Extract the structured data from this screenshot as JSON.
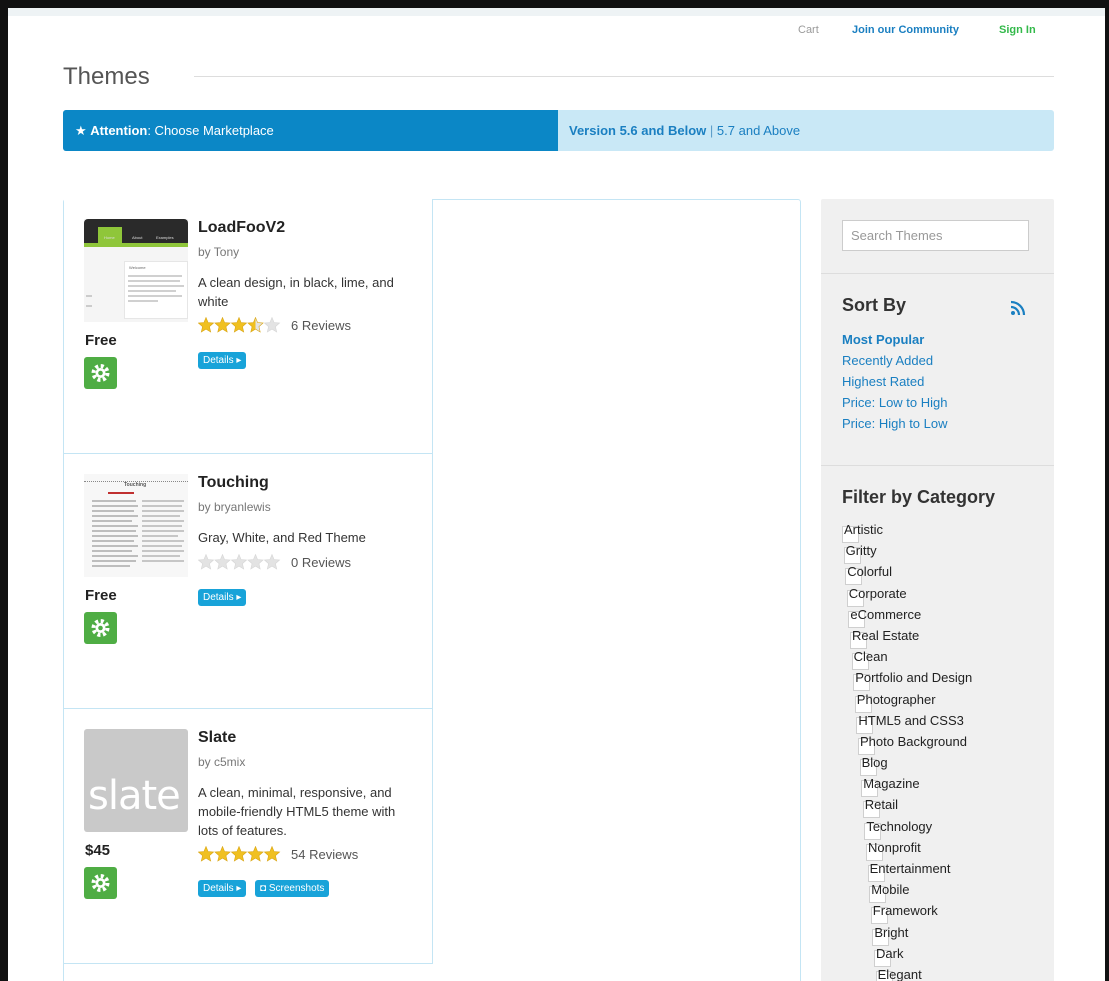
{
  "top_links": {
    "cart": "Cart",
    "join": "Join our Community",
    "sign_in": "Sign In"
  },
  "page_title": "Themes",
  "attention": {
    "label": "Attention",
    "text": ": Choose Marketplace",
    "version_old": "Version 5.6 and Below",
    "separator": "|",
    "version_new": "5.7 and Above"
  },
  "themes": [
    {
      "name": "LoadFooV2",
      "author": "by Tony",
      "description": "A clean design, in black, lime, and white",
      "rating": 3.5,
      "reviews": "6 Reviews",
      "price": "Free",
      "details_label": "Details",
      "thumb_caption": "Welcome"
    },
    {
      "name": "Touching",
      "author": "by bryanlewis",
      "description": "Gray, White, and Red Theme",
      "rating": 0,
      "reviews": "0 Reviews",
      "price": "Free",
      "details_label": "Details",
      "thumb_caption": "Touching"
    },
    {
      "name": "Slate",
      "author": "by c5mix",
      "description": "A clean, minimal, responsive, and mobile-friendly HTML5 theme with lots of features.",
      "rating": 5,
      "reviews": "54 Reviews",
      "price": "$45",
      "details_label": "Details",
      "screenshots_label": "Screenshots",
      "thumb_caption": "slate"
    }
  ],
  "colors": {
    "accent_blue": "#0b87c6",
    "link_blue": "#1a7fc1",
    "green": "#4fad44",
    "star_gold": "#f0c020",
    "star_empty": "#e3e3e3"
  },
  "sidebar": {
    "search_placeholder": "Search Themes",
    "sort_heading": "Sort By",
    "sort_options": [
      {
        "label": "Most Popular",
        "active": true
      },
      {
        "label": "Recently Added",
        "active": false
      },
      {
        "label": "Highest Rated",
        "active": false
      },
      {
        "label": "Price: Low to High",
        "active": false
      },
      {
        "label": "Price: High to Low",
        "active": false
      }
    ],
    "filter_heading": "Filter by Category",
    "categories": [
      "Artistic",
      "Gritty",
      "Colorful",
      "Corporate",
      "eCommerce",
      "Real Estate",
      "Clean",
      "Portfolio and Design",
      "Photographer",
      "HTML5 and CSS3",
      "Photo Background",
      "Blog",
      "Magazine",
      "Retail",
      "Technology",
      "Nonprofit",
      "Entertainment",
      "Mobile",
      "Framework",
      "Bright",
      "Dark",
      "Elegant"
    ]
  }
}
